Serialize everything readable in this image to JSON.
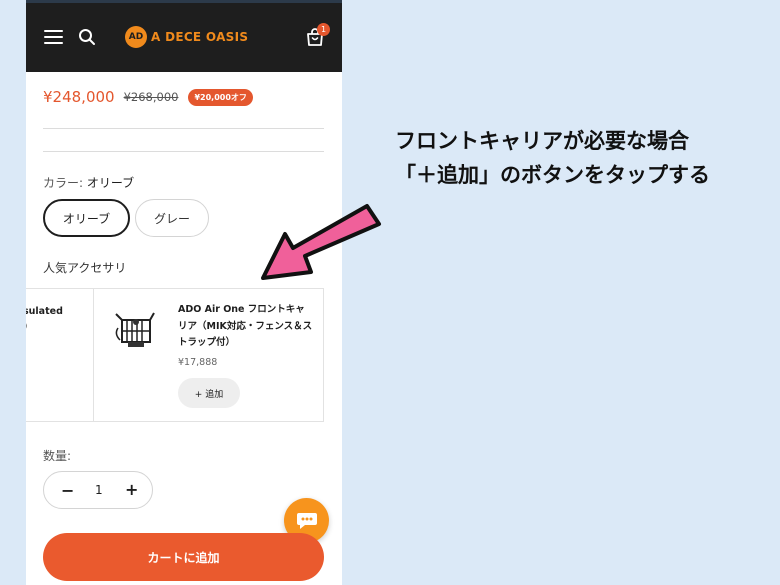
{
  "header": {
    "logo_mark": "AD",
    "logo_text": "A DECE OASIS",
    "cart_count": "1"
  },
  "product": {
    "price": "¥248,000",
    "compare_price": "¥268,000",
    "discount_badge": "¥20,000オフ"
  },
  "variant": {
    "label": "カラー:",
    "selected_value": "オリーブ",
    "options": [
      "オリーブ",
      "グレー"
    ]
  },
  "accessories": {
    "heading": "人気アクセサリ",
    "prev_item_title": "sulated\n)",
    "item": {
      "title": "ADO Air One フロントキャリア（MIK対応・フェンス＆ストラップ付）",
      "price": "¥17,888",
      "add_label": "+ 追加"
    }
  },
  "quantity": {
    "label": "数量:",
    "value": "1",
    "minus": "−",
    "plus": "+"
  },
  "cart_button_label": "カートに追加",
  "annotation": {
    "line1": "フロントキャリアが必要な場合",
    "line2": "「＋追加」のボタンをタップする"
  },
  "colors": {
    "accent": "#e4572e",
    "header_bg": "#1e1e1e",
    "logo": "#f08a1c",
    "chat": "#f7941d",
    "arrow": "#f0609a",
    "background": "#dbe9f7"
  }
}
